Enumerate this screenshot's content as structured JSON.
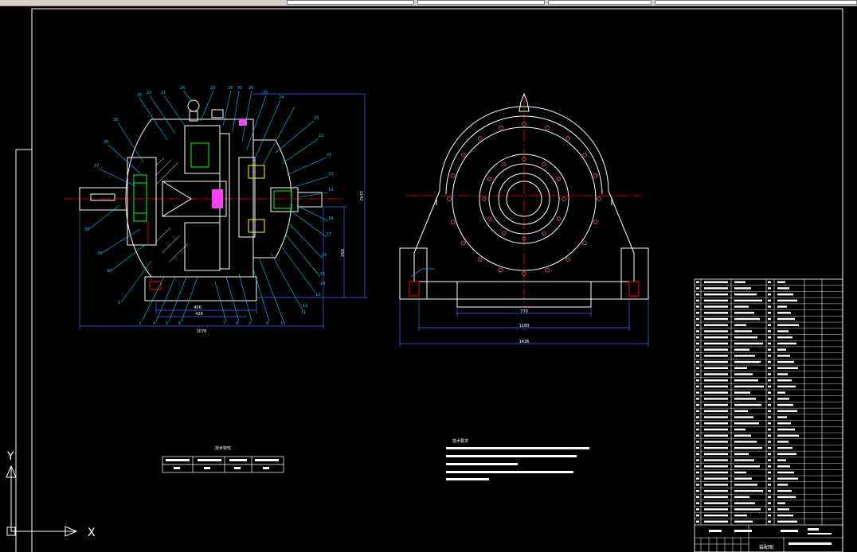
{
  "drawing": {
    "title_block_label": "装配图",
    "dims_left": {
      "d_406": "406",
      "d_426": "426",
      "d_1078": "1078",
      "d_1142": "1142",
      "d_650": "650"
    },
    "dims_right": {
      "d_770": "770",
      "d_1160": "1160",
      "d_1436": "1436"
    },
    "tech_table": {
      "title": "技术特性"
    },
    "notes": {
      "title": "技术要求"
    },
    "ucs": {
      "x": "X",
      "y": "Y"
    }
  },
  "parts_numbers": {
    "top": [
      "25",
      "22",
      "21",
      "20",
      "29",
      "28",
      "27",
      "26",
      "25",
      "24"
    ],
    "left": [
      "35",
      "36",
      "37",
      "38",
      "39",
      "40",
      "1"
    ],
    "bottom": [
      "3",
      "4",
      "5",
      "6",
      "7",
      "8",
      "2",
      "9",
      "10",
      "11",
      "12"
    ],
    "right": [
      "23",
      "22",
      "21",
      "20",
      "19",
      "18",
      "17",
      "16",
      "15",
      "14",
      "13"
    ]
  },
  "colors": {
    "background": "#000000",
    "outline": "#ffffff",
    "center_line": "#ff0000",
    "hole": "#ff6060",
    "dimension": "#3c6cff",
    "leader": "#00c8ff",
    "text_green": "#00ff00",
    "magenta": "#ff40ff",
    "yellow": "#ffff00"
  }
}
